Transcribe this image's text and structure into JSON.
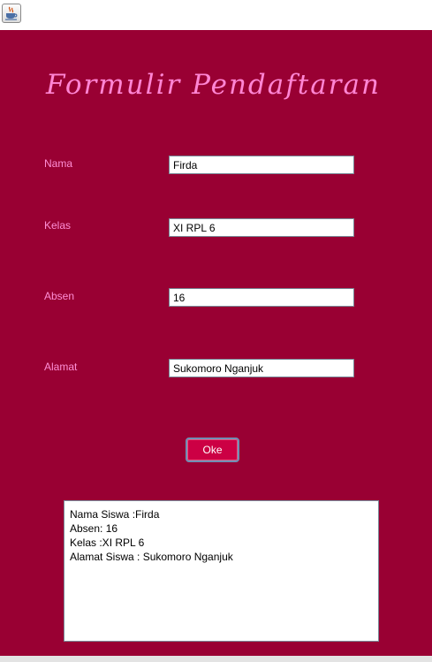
{
  "window": {
    "icon": "java-coffee-cup-icon"
  },
  "form": {
    "title": "Formulir Pendaftaran",
    "fields": [
      {
        "label": "Nama",
        "value": "Firda"
      },
      {
        "label": "Kelas",
        "value": "XI RPL 6"
      },
      {
        "label": "Absen",
        "value": "16"
      },
      {
        "label": "Alamat",
        "value": "Sukomoro Nganjuk"
      }
    ],
    "submit_label": "Oke"
  },
  "output": {
    "lines": [
      "Nama Siswa :Firda",
      "Absen: 16",
      "Kelas :XI RPL 6",
      "Alamat Siswa : Sukomoro Nganjuk"
    ]
  },
  "colors": {
    "panel_background": "#990033",
    "title_text": "#ff85d4",
    "label_text": "#ff8fd6",
    "button_background": "#cc0044"
  }
}
